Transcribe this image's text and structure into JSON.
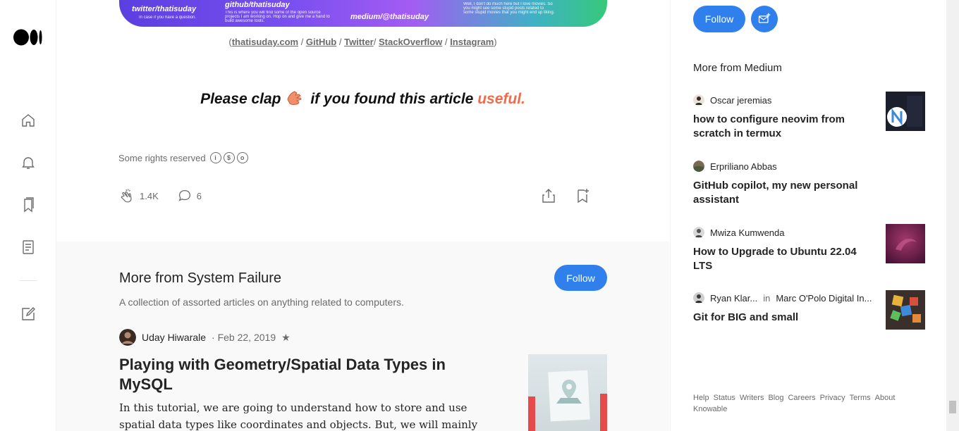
{
  "banner": {
    "twitter": "twitter/thatisuday",
    "twitter_small": "In case if you have a question.",
    "github": "github/thatisuday",
    "github_small": "This is where you will find some of the open source projects I am working on. Hop on and give me a hand to build awesome tools.",
    "medium": "medium/@thatisuday",
    "medium_small": "Well, I don't do much here but I love movies. So you might see some stupid posts related to some stupid movies that you might end up liking."
  },
  "links": {
    "open": "(",
    "site": "thatisuday.com",
    "sep1": " / ",
    "github": "GitHub",
    "sep2": " / ",
    "twitter": "Twitter",
    "sep3": "/ ",
    "stackoverflow": "StackOverflow",
    "sep4": " / ",
    "instagram": "Instagram",
    "close": ")"
  },
  "clap": {
    "before": "Please clap",
    "after": " if you found this article ",
    "highlight": "useful."
  },
  "rights": "Some rights reserved",
  "actions": {
    "claps": "1.4K",
    "responses": "6"
  },
  "more_pub": {
    "title": "More from System Failure",
    "description": "A collection of assorted articles on anything related to computers.",
    "follow": "Follow",
    "article": {
      "author": "Uday Hiwarale",
      "date": "· Feb 22, 2019",
      "star": "★",
      "title": "Playing with Geometry/Spatial Data Types in MySQL",
      "subtitle": "In this tutorial, we are going to understand how to store and use spatial data types like coordinates and objects. But, we will mainly focus on Points"
    }
  },
  "sidebar": {
    "follow": "Follow",
    "more_heading": "More from Medium",
    "recs": [
      {
        "author": "Oscar jeremias",
        "in": "",
        "pub": "",
        "title": "how to configure neovim from scratch in termux"
      },
      {
        "author": "Erpriliano Abbas",
        "in": "",
        "pub": "",
        "title": "GitHub copilot, my new personal assistant"
      },
      {
        "author": "Mwiza Kumwenda",
        "in": "",
        "pub": "",
        "title": "How to Upgrade to Ubuntu 22.04 LTS"
      },
      {
        "author": "Ryan Klar...",
        "in": "in",
        "pub": "Marc O'Polo Digital In...",
        "title": "Git for BIG and small"
      }
    ],
    "footer": [
      "Help",
      "Status",
      "Writers",
      "Blog",
      "Careers",
      "Privacy",
      "Terms",
      "About",
      "Knowable"
    ]
  },
  "colors": {
    "accent": "#2f80ed",
    "useful": "#ee6c4d",
    "muted": "#6b6b6b"
  }
}
